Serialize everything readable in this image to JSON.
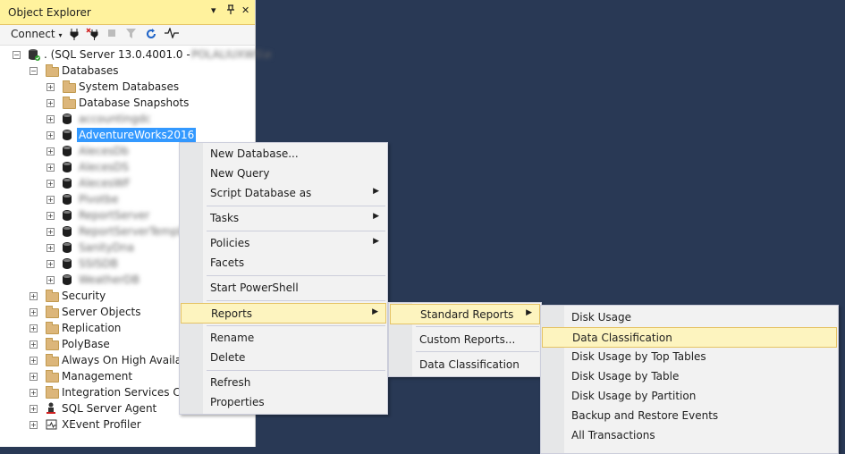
{
  "panel": {
    "title": "Object Explorer",
    "title_controls": [
      "▾",
      " ↕",
      "✕"
    ],
    "connect_label": "Connect"
  },
  "tree": {
    "server": ". (SQL Server 13.0.4001.0 - ",
    "server_blurred": "POLALIUXWS\\e",
    "databases": "Databases",
    "system_databases": "System Databases",
    "database_snapshots": "Database Snapshots",
    "blurred_db_1": "accountingdc",
    "selected_db": "AdventureWorks2016",
    "blurred_dbs": [
      "AlecesDb",
      "AlecesDS",
      "AlecesWF",
      "Pivotbe",
      "ReportServer",
      "ReportServerTempDB",
      "SanityDna",
      "SSISDB",
      "WeatherDB"
    ],
    "security": "Security",
    "server_objects": "Server Objects",
    "replication": "Replication",
    "polybase": "PolyBase",
    "always_on": "Always On High Availabi",
    "management": "Management",
    "integration_services": "Integration Services Cata",
    "sql_agent": "SQL Server Agent",
    "xevent": "XEvent Profiler"
  },
  "menu1": {
    "items": [
      "New Database...",
      "New Query",
      "Script Database as",
      "Tasks",
      "Policies",
      "Facets",
      "Start PowerShell",
      "Reports",
      "Rename",
      "Delete",
      "Refresh",
      "Properties"
    ]
  },
  "menu2": {
    "items": [
      "Standard Reports",
      "Custom Reports...",
      "Data Classification"
    ]
  },
  "menu3": {
    "items": [
      "Disk Usage",
      "Data Classification",
      "Disk Usage by Top Tables",
      "Disk Usage by Table",
      "Disk Usage by Partition",
      "Backup and Restore Events",
      "All Transactions"
    ]
  },
  "colors": {
    "background": "#293955",
    "title_bar": "#fff29d",
    "selection": "#3399ff",
    "menu_highlight": "#fdf4bf"
  }
}
